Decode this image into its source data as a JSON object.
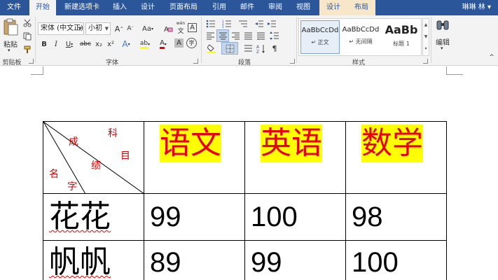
{
  "tabs": [
    {
      "id": "file",
      "label": "文件"
    },
    {
      "id": "home",
      "label": "开始"
    },
    {
      "id": "newtab",
      "label": "新建选项卡"
    },
    {
      "id": "insert",
      "label": "插入"
    },
    {
      "id": "design",
      "label": "设计"
    },
    {
      "id": "layout",
      "label": "页面布局"
    },
    {
      "id": "references",
      "label": "引用"
    },
    {
      "id": "mailings",
      "label": "邮件"
    },
    {
      "id": "review",
      "label": "审阅"
    },
    {
      "id": "view",
      "label": "视图"
    },
    {
      "id": "table_design",
      "label": "设计"
    },
    {
      "id": "table_layout",
      "label": "布局"
    }
  ],
  "user": {
    "name": "琳琳 林",
    "arrow": "▾"
  },
  "clipboard": {
    "paste_label": "粘贴",
    "group_label": "剪贴板"
  },
  "font": {
    "name": "宋体 (中文正)",
    "size": "小初",
    "grow": "A",
    "shrink": "A",
    "case": "Aa",
    "phonetic": "wén",
    "charborder": "A",
    "bold": "B",
    "italic": "I",
    "underline": "U",
    "strike": "abc",
    "sub": "x₂",
    "sup": "x²",
    "effects": "A",
    "highlight": "ab",
    "color": "A",
    "shade": "A",
    "encircle": "字",
    "group_label": "字体"
  },
  "paragraph": {
    "group_label": "段落"
  },
  "styles": {
    "items": [
      {
        "sample": "AaBbCcDd",
        "name": "↵ 正文"
      },
      {
        "sample": "AaBbCcDd",
        "name": "↵ 无间隔"
      },
      {
        "sample": "AaBb",
        "name": "标题 1"
      }
    ],
    "group_label": "样式"
  },
  "editing": {
    "label": "编辑"
  },
  "colors": {
    "ribbon_blue": "#2b579a",
    "highlight_yellow": "#ffff00",
    "header_red": "#e8000e"
  },
  "table": {
    "corner": {
      "ke": "科",
      "mu": "目",
      "cheng": "成",
      "ji": "绩",
      "ming": "名",
      "zi": "字"
    },
    "headers": [
      "语文",
      "英语",
      "数学"
    ],
    "rows": [
      {
        "name": "花花",
        "scores": [
          "99",
          "100",
          "98"
        ]
      },
      {
        "name": "帆帆",
        "scores": [
          "89",
          "99",
          "100"
        ]
      }
    ]
  }
}
